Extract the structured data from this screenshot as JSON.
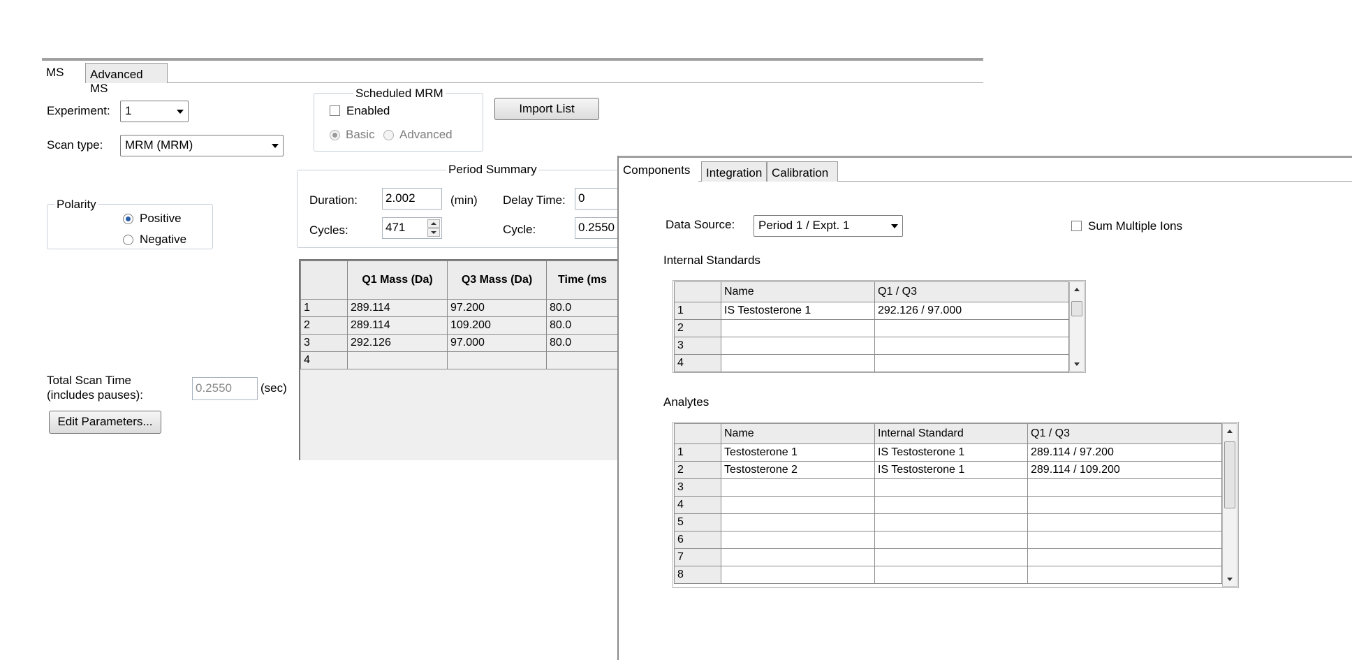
{
  "ms_panel": {
    "tabs": [
      "MS",
      "Advanced MS"
    ],
    "experiment_label": "Experiment:",
    "experiment_value": "1",
    "scan_type_label": "Scan type:",
    "scan_type_value": "MRM (MRM)",
    "scheduled_mrm": {
      "title": "Scheduled MRM",
      "enabled_label": "Enabled",
      "basic_label": "Basic",
      "advanced_label": "Advanced"
    },
    "import_list_label": "Import List",
    "polarity": {
      "title": "Polarity",
      "positive_label": "Positive",
      "negative_label": "Negative"
    },
    "period_summary": {
      "title": "Period Summary",
      "duration_label": "Duration:",
      "duration_value": "2.002",
      "duration_unit": "(min)",
      "delay_label": "Delay Time:",
      "delay_value": "0",
      "cycles_label": "Cycles:",
      "cycles_value": "471",
      "cycle_label": "Cycle:",
      "cycle_value": "0.2550"
    },
    "mass_table": {
      "headers": [
        "Q1 Mass (Da)",
        "Q3 Mass (Da)",
        "Time (ms"
      ],
      "rows": [
        {
          "n": "1",
          "q1": "289.114",
          "q3": "97.200",
          "time": "80.0"
        },
        {
          "n": "2",
          "q1": "289.114",
          "q3": "109.200",
          "time": "80.0"
        },
        {
          "n": "3",
          "q1": "292.126",
          "q3": "97.000",
          "time": "80.0"
        },
        {
          "n": "4",
          "q1": "",
          "q3": "",
          "time": ""
        }
      ]
    },
    "total_scan_time_label_1": "Total Scan Time",
    "total_scan_time_label_2": "(includes pauses):",
    "total_scan_time_value": "0.2550",
    "total_scan_time_unit": "(sec)",
    "edit_parameters_label": "Edit Parameters..."
  },
  "components_panel": {
    "tabs": [
      "Components",
      "Integration",
      "Calibration"
    ],
    "data_source_label": "Data Source:",
    "data_source_value": "Period 1 / Expt. 1",
    "sum_multiple_ions_label": "Sum Multiple Ions",
    "internal_standards": {
      "title": "Internal Standards",
      "headers": [
        "Name",
        "Q1 / Q3"
      ],
      "rows": [
        {
          "n": "1",
          "name": "IS Testosterone 1",
          "q": "292.126 / 97.000"
        },
        {
          "n": "2",
          "name": "",
          "q": ""
        },
        {
          "n": "3",
          "name": "",
          "q": ""
        },
        {
          "n": "4",
          "name": "",
          "q": ""
        }
      ]
    },
    "analytes": {
      "title": "Analytes",
      "headers": [
        "Name",
        "Internal Standard",
        "Q1 / Q3"
      ],
      "rows": [
        {
          "n": "1",
          "name": "Testosterone 1",
          "is": "IS Testosterone 1",
          "q": "289.114 / 97.200"
        },
        {
          "n": "2",
          "name": "Testosterone 2",
          "is": "IS Testosterone 1",
          "q": "289.114 / 109.200"
        },
        {
          "n": "3",
          "name": "",
          "is": "",
          "q": ""
        },
        {
          "n": "4",
          "name": "",
          "is": "",
          "q": ""
        },
        {
          "n": "5",
          "name": "",
          "is": "",
          "q": ""
        },
        {
          "n": "6",
          "name": "",
          "is": "",
          "q": ""
        },
        {
          "n": "7",
          "name": "",
          "is": "",
          "q": ""
        },
        {
          "n": "8",
          "name": "",
          "is": "",
          "q": ""
        }
      ]
    }
  }
}
